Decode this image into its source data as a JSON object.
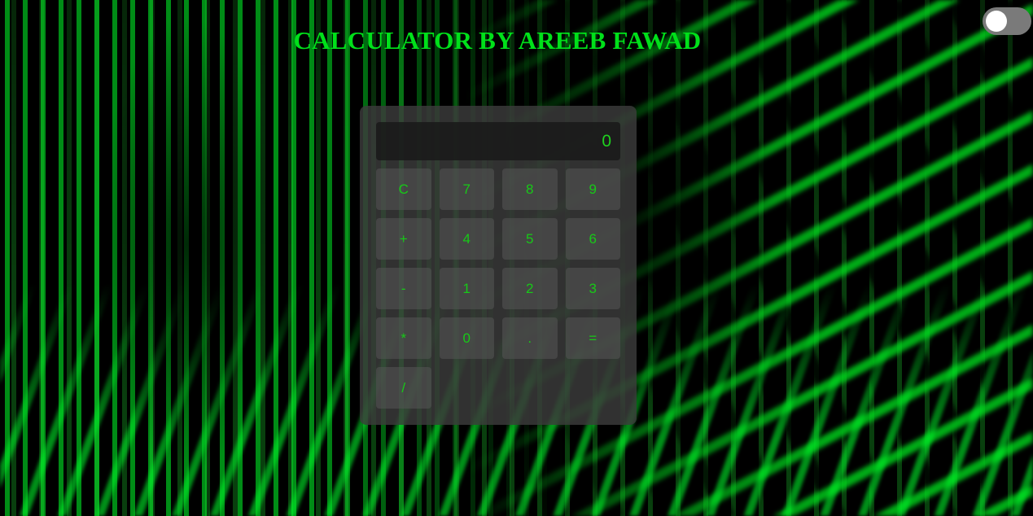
{
  "page": {
    "title": "CALCULATOR BY AREEB FAWAD",
    "title_color": "#00e01a",
    "accent_color": "#1ed11e"
  },
  "theme_toggle": {
    "state": "off",
    "track_color": "#7a7a7a",
    "knob_color": "#ffffff"
  },
  "calculator": {
    "display_value": "0",
    "keys": [
      {
        "label": "C",
        "name": "clear-button"
      },
      {
        "label": "7",
        "name": "digit-7-button"
      },
      {
        "label": "8",
        "name": "digit-8-button"
      },
      {
        "label": "9",
        "name": "digit-9-button"
      },
      {
        "label": "+",
        "name": "add-button"
      },
      {
        "label": "4",
        "name": "digit-4-button"
      },
      {
        "label": "5",
        "name": "digit-5-button"
      },
      {
        "label": "6",
        "name": "digit-6-button"
      },
      {
        "label": "-",
        "name": "subtract-button"
      },
      {
        "label": "1",
        "name": "digit-1-button"
      },
      {
        "label": "2",
        "name": "digit-2-button"
      },
      {
        "label": "3",
        "name": "digit-3-button"
      },
      {
        "label": "*",
        "name": "multiply-button"
      },
      {
        "label": "0",
        "name": "digit-0-button"
      },
      {
        "label": ".",
        "name": "decimal-button"
      },
      {
        "label": "=",
        "name": "equals-button"
      },
      {
        "label": "/",
        "name": "divide-button"
      }
    ]
  }
}
